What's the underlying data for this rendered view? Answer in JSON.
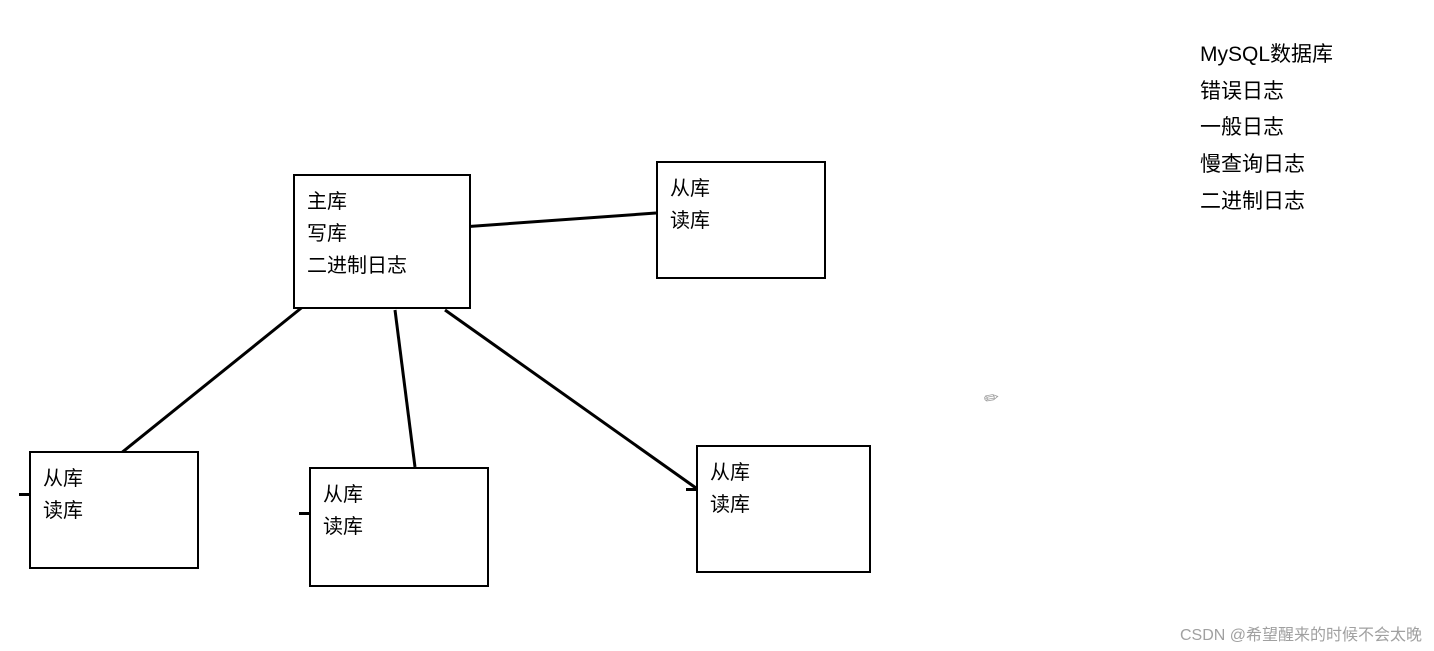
{
  "nodes": {
    "master": {
      "line1": "主库",
      "line2": "写库",
      "line3": "二进制日志"
    },
    "slave_right_top": {
      "line1": "从库",
      "line2": "读库"
    },
    "slave_bottom_left": {
      "line1": "从库",
      "line2": "读库"
    },
    "slave_bottom_mid": {
      "line1": "从库",
      "line2": "读库"
    },
    "slave_bottom_right": {
      "line1": "从库",
      "line2": "读库"
    }
  },
  "sidebar": {
    "items": [
      "MySQL数据库",
      "错误日志",
      "一般日志",
      "慢查询日志",
      "二进制日志"
    ]
  },
  "watermark": "CSDN @希望醒来的时候不会太晚"
}
